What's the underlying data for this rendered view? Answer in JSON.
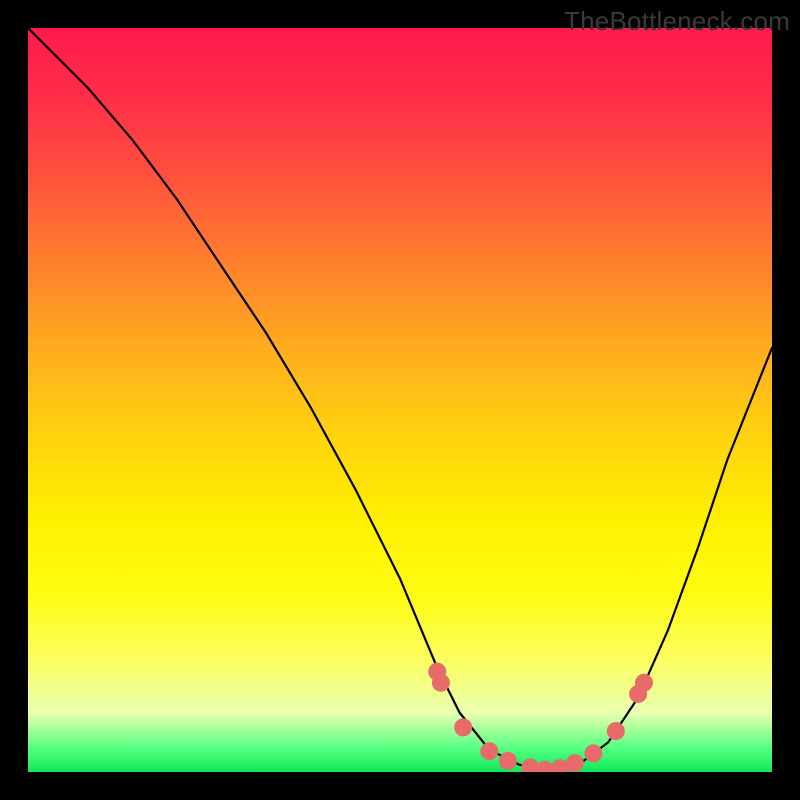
{
  "watermark": "TheBottleneck.com",
  "chart_data": {
    "type": "line",
    "title": "",
    "xlabel": "",
    "ylabel": "",
    "xlim": [
      0,
      100
    ],
    "ylim": [
      0,
      100
    ],
    "series": [
      {
        "name": "curve",
        "x": [
          0,
          3,
          8,
          14,
          20,
          26,
          32,
          38,
          44,
          50,
          55,
          58,
          62,
          66,
          70,
          74,
          78,
          82,
          86,
          90,
          94,
          98,
          100
        ],
        "y": [
          100,
          97,
          92,
          85,
          77,
          68,
          59,
          49,
          38,
          26,
          14,
          8,
          3,
          1,
          0,
          1,
          4,
          10,
          19,
          30,
          42,
          52,
          57
        ]
      },
      {
        "name": "markers",
        "x": [
          55.0,
          55.5,
          58.5,
          62.0,
          64.5,
          67.5,
          69.5,
          71.5,
          73.5,
          76.0,
          79.0,
          82.0,
          82.8
        ],
        "y": [
          13.5,
          12.0,
          6.0,
          2.8,
          1.5,
          0.6,
          0.3,
          0.5,
          1.2,
          2.5,
          5.5,
          10.5,
          12.0
        ]
      }
    ],
    "gradient_stops": [
      {
        "pos": 0,
        "color": "#ff1a4d"
      },
      {
        "pos": 50,
        "color": "#ffd010"
      },
      {
        "pos": 95,
        "color": "#eaffb0"
      },
      {
        "pos": 100,
        "color": "#10e858"
      }
    ],
    "marker_color": "#e86a6a",
    "curve_color": "#000000"
  }
}
